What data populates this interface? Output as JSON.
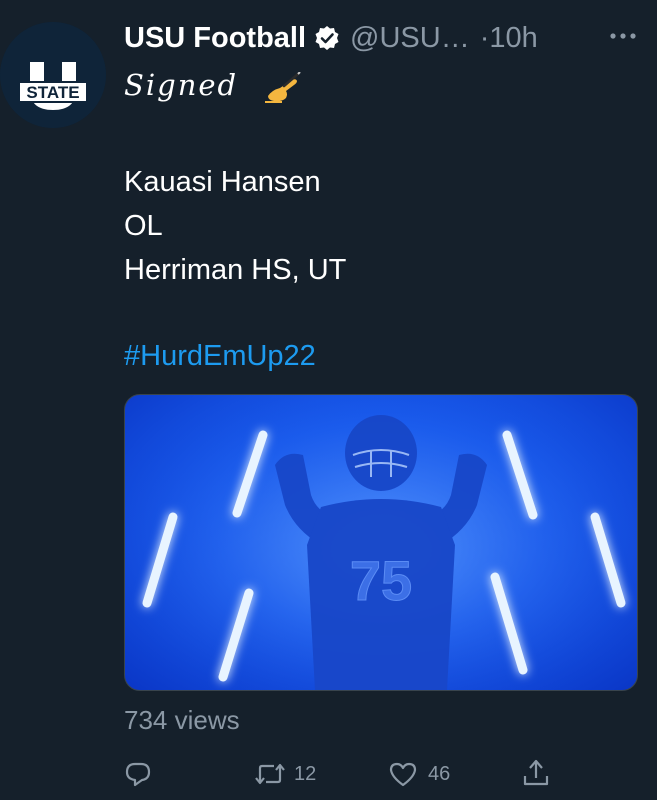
{
  "tweet": {
    "author": {
      "name": "USU Football",
      "handle": "@USU…",
      "logo_text": "STATE"
    },
    "time": "·10h",
    "signed_text": "Signed",
    "lines": [
      "Kauasi Hansen",
      "OL",
      "Herriman HS, UT"
    ],
    "hashtag": "#HurdEmUp22",
    "media": {
      "jersey_number": "75"
    },
    "views": "734 views",
    "actions": {
      "retweets": "12",
      "likes": "46"
    }
  },
  "colors": {
    "background": "#15202b",
    "text": "#ffffff",
    "secondary": "#8b98a5",
    "link": "#1d9bf0",
    "media_blue": "#1a5ef0"
  },
  "icons": [
    "verified-icon",
    "more-icon",
    "writing-hand-icon",
    "reply-icon",
    "retweet-icon",
    "like-icon",
    "share-icon"
  ]
}
